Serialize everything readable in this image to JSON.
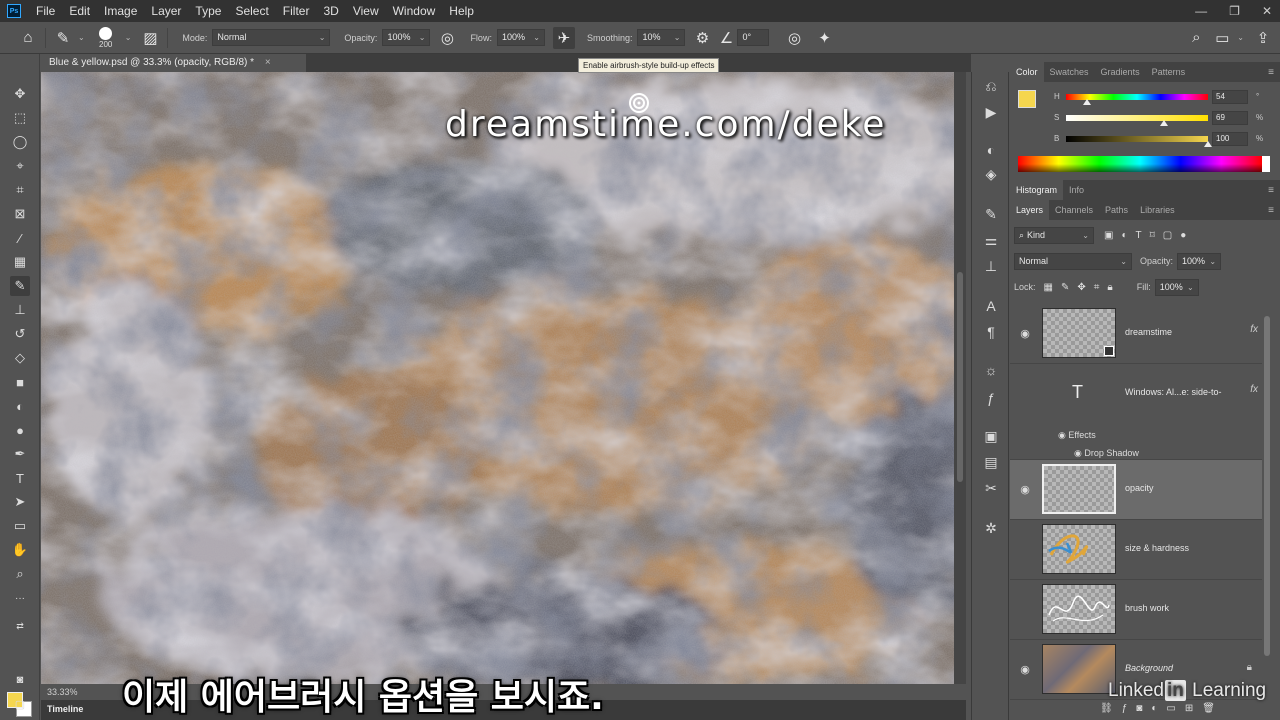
{
  "app": {
    "logo_text": "Ps",
    "menu": [
      "File",
      "Edit",
      "Image",
      "Layer",
      "Type",
      "Select",
      "Filter",
      "3D",
      "View",
      "Window",
      "Help"
    ],
    "window_controls": [
      "—",
      "❐",
      "✕"
    ]
  },
  "options_bar": {
    "brush_size": "200",
    "mode_label": "Mode:",
    "mode_value": "Normal",
    "opacity_label": "Opacity:",
    "opacity_value": "100%",
    "flow_label": "Flow:",
    "flow_value": "100%",
    "smoothing_label": "Smoothing:",
    "smoothing_value": "10%",
    "angle_value": "0°",
    "tooltip": "Enable airbrush-style build-up effects"
  },
  "document": {
    "tab_title": "Blue & yellow.psd @ 33.3% (opacity, RGB/8) *",
    "tab_close": "×",
    "zoom": "33.33%",
    "watermark": "dreamstime.com/deke"
  },
  "timeline_label": "Timeline",
  "subtitle": "이제 에어브러시 옵션을 보시죠.",
  "branding": {
    "linkedin_a": "Linked",
    "linkedin_in": "in",
    "linkedin_b": " Learning"
  },
  "color_panel": {
    "tabs": [
      "Color",
      "Swatches",
      "Gradients",
      "Patterns"
    ],
    "foreground": "#f5d64e",
    "h": {
      "label": "H",
      "value": "54",
      "unit": "°",
      "fraction": 0.15
    },
    "s": {
      "label": "S",
      "value": "69",
      "unit": "%",
      "fraction": 0.69
    },
    "b": {
      "label": "B",
      "value": "100",
      "unit": "%",
      "fraction": 1.0
    }
  },
  "histogram_panel": {
    "tabs": [
      "Histogram",
      "Info"
    ]
  },
  "layers_panel": {
    "tabs": [
      "Layers",
      "Channels",
      "Paths",
      "Libraries"
    ],
    "filter_kind": "Kind",
    "blend_mode": "Normal",
    "opacity_label": "Opacity:",
    "opacity_value": "100%",
    "lock_label": "Lock:",
    "fill_label": "Fill:",
    "fill_value": "100%",
    "layers": [
      {
        "name": "dreamstime",
        "visible": true,
        "fx": "fx"
      },
      {
        "name": "Windows: Al...e: side-to-",
        "visible": false,
        "fx": "fx",
        "effects_label": "Effects",
        "effect_item": "Drop Shadow"
      },
      {
        "name": "opacity",
        "visible": true,
        "selected": true
      },
      {
        "name": "size & hardness",
        "visible": false
      },
      {
        "name": "brush work",
        "visible": false
      },
      {
        "name": "Background",
        "visible": true,
        "locked": true
      }
    ]
  }
}
